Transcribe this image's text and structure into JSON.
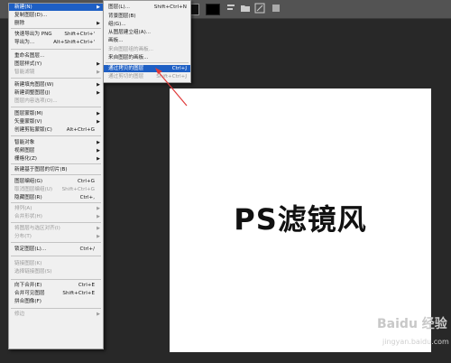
{
  "canvas": {
    "title": "PS滤镜风"
  },
  "watermark": {
    "main": "Baidu 经验",
    "sub": "jingyan.baidu.com"
  },
  "colors": {
    "menu_bg": "#f0f0f0",
    "highlight": "#1e5fc4",
    "canvas": "#ffffff",
    "workspace": "#282828",
    "arrow": "#e03a3a"
  },
  "menu": {
    "items": [
      {
        "label": "新建(N)",
        "shortcut": "",
        "submenu": true,
        "disabled": false,
        "highlighted": true
      },
      {
        "label": "复制图层(D)...",
        "shortcut": "",
        "submenu": false,
        "disabled": false
      },
      {
        "label": "删除",
        "shortcut": "",
        "submenu": true,
        "disabled": false
      },
      {
        "label": "快速导出为 PNG",
        "shortcut": "Shift+Ctrl+'",
        "submenu": false,
        "disabled": false
      },
      {
        "label": "导出为...",
        "shortcut": "Alt+Shift+Ctrl+'",
        "submenu": false,
        "disabled": false
      },
      {
        "label": "重命名图层...",
        "shortcut": "",
        "submenu": false,
        "disabled": false
      },
      {
        "label": "图层样式(Y)",
        "shortcut": "",
        "submenu": true,
        "disabled": false
      },
      {
        "label": "智能滤镜",
        "shortcut": "",
        "submenu": true,
        "disabled": true
      },
      {
        "label": "新建填充图层(W)",
        "shortcut": "",
        "submenu": true,
        "disabled": false
      },
      {
        "label": "新建调整图层(J)",
        "shortcut": "",
        "submenu": true,
        "disabled": false
      },
      {
        "label": "图层内容选项(O)...",
        "shortcut": "",
        "submenu": false,
        "disabled": true
      },
      {
        "label": "图层蒙版(M)",
        "shortcut": "",
        "submenu": true,
        "disabled": false
      },
      {
        "label": "矢量蒙版(V)",
        "shortcut": "",
        "submenu": true,
        "disabled": false
      },
      {
        "label": "创建剪贴蒙版(C)",
        "shortcut": "Alt+Ctrl+G",
        "submenu": false,
        "disabled": false
      },
      {
        "label": "智能对象",
        "shortcut": "",
        "submenu": true,
        "disabled": false
      },
      {
        "label": "视频图层",
        "shortcut": "",
        "submenu": true,
        "disabled": false
      },
      {
        "label": "栅格化(Z)",
        "shortcut": "",
        "submenu": true,
        "disabled": false
      },
      {
        "label": "新建基于图层的切片(B)",
        "shortcut": "",
        "submenu": false,
        "disabled": false
      },
      {
        "label": "图层编组(G)",
        "shortcut": "Ctrl+G",
        "submenu": false,
        "disabled": false
      },
      {
        "label": "取消图层编组(U)",
        "shortcut": "Shift+Ctrl+G",
        "submenu": false,
        "disabled": true
      },
      {
        "label": "隐藏图层(R)",
        "shortcut": "Ctrl+,",
        "submenu": false,
        "disabled": false
      },
      {
        "label": "排列(A)",
        "shortcut": "",
        "submenu": true,
        "disabled": true
      },
      {
        "label": "合并形状(H)",
        "shortcut": "",
        "submenu": true,
        "disabled": true
      },
      {
        "label": "将图层与选区对齐(I)",
        "shortcut": "",
        "submenu": true,
        "disabled": true
      },
      {
        "label": "分布(T)",
        "shortcut": "",
        "submenu": true,
        "disabled": true
      },
      {
        "label": "锁定图层(L)...",
        "shortcut": "Ctrl+/",
        "submenu": false,
        "disabled": false
      },
      {
        "label": "链接图层(K)",
        "shortcut": "",
        "submenu": false,
        "disabled": true
      },
      {
        "label": "选择链接图层(S)",
        "shortcut": "",
        "submenu": false,
        "disabled": true
      },
      {
        "label": "向下合并(E)",
        "shortcut": "Ctrl+E",
        "submenu": false,
        "disabled": false
      },
      {
        "label": "合并可见图层",
        "shortcut": "Shift+Ctrl+E",
        "submenu": false,
        "disabled": false
      },
      {
        "label": "拼合图像(F)",
        "shortcut": "",
        "submenu": false,
        "disabled": false
      },
      {
        "label": "修边",
        "shortcut": "",
        "submenu": true,
        "disabled": true
      }
    ]
  },
  "submenu": {
    "items": [
      {
        "label": "图层(L)...",
        "shortcut": "Shift+Ctrl+N",
        "disabled": false,
        "highlighted": false
      },
      {
        "label": "背景图层(B)",
        "shortcut": "",
        "disabled": false,
        "highlighted": false
      },
      {
        "label": "组(G)...",
        "shortcut": "",
        "disabled": false,
        "highlighted": false
      },
      {
        "label": "从图层建立组(A)...",
        "shortcut": "",
        "disabled": false,
        "highlighted": false
      },
      {
        "label": "画板...",
        "shortcut": "",
        "disabled": false,
        "highlighted": false
      },
      {
        "label": "来自图层组的画板...",
        "shortcut": "",
        "disabled": true,
        "highlighted": false
      },
      {
        "label": "来自图层的画板...",
        "shortcut": "",
        "disabled": false,
        "highlighted": false
      },
      {
        "label": "通过拷贝的图层",
        "shortcut": "Ctrl+J",
        "disabled": false,
        "highlighted": true
      },
      {
        "label": "通过剪切的图层",
        "shortcut": "Shift+Ctrl+J",
        "disabled": true,
        "highlighted": false
      }
    ]
  }
}
